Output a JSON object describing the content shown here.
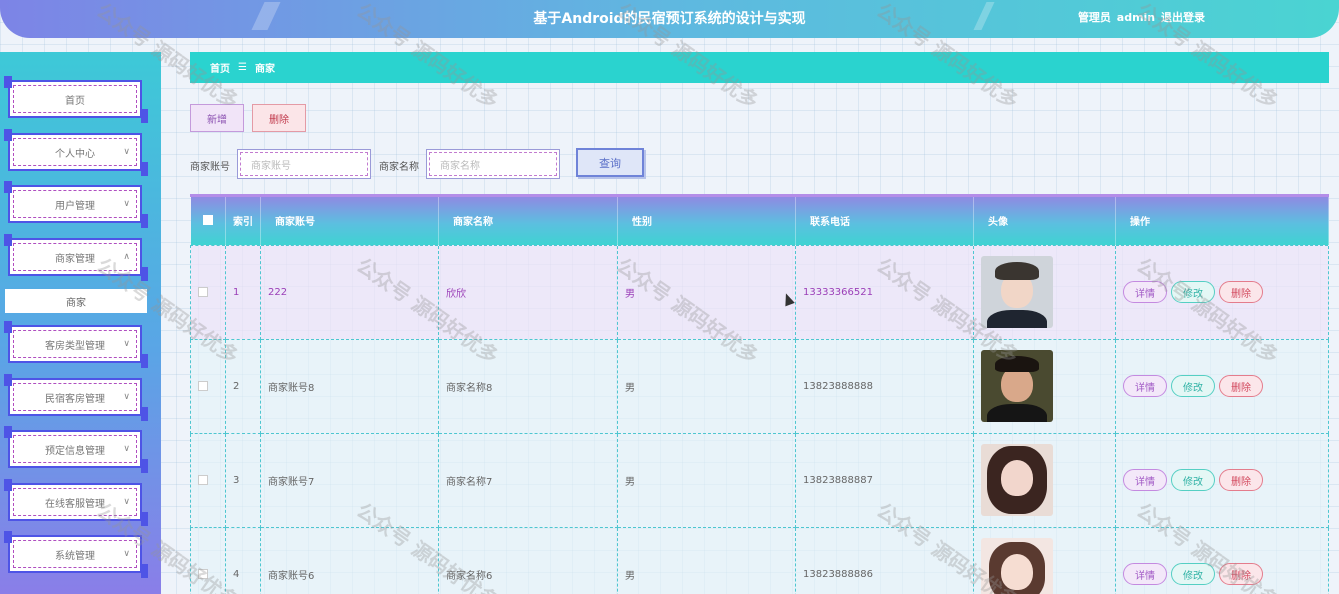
{
  "header": {
    "title": "基于Android的民宿预订系统的设计与实现",
    "user_role": "管理员",
    "username": "admin",
    "logout": "退出登录"
  },
  "sidebar": {
    "items": [
      {
        "label": "首页",
        "has_chevron": false
      },
      {
        "label": "个人中心",
        "has_chevron": true
      },
      {
        "label": "用户管理",
        "has_chevron": true
      },
      {
        "label": "商家管理",
        "has_chevron": true,
        "expanded": true
      },
      {
        "label": "客房类型管理",
        "has_chevron": true
      },
      {
        "label": "民宿客房管理",
        "has_chevron": true
      },
      {
        "label": "预定信息管理",
        "has_chevron": true
      },
      {
        "label": "在线客服管理",
        "has_chevron": true
      },
      {
        "label": "系统管理",
        "has_chevron": true
      }
    ],
    "submenu_active": "商家"
  },
  "breadcrumb": {
    "home": "首页",
    "separator": "☰",
    "current": "商家"
  },
  "toolbar": {
    "add_label": "新增",
    "delete_label": "删除"
  },
  "search": {
    "account_label": "商家账号",
    "account_placeholder": "商家账号",
    "name_label": "商家名称",
    "name_placeholder": "商家名称",
    "query_label": "查询"
  },
  "table": {
    "headers": {
      "index": "索引",
      "account": "商家账号",
      "name": "商家名称",
      "gender": "性别",
      "phone": "联系电话",
      "avatar": "头像",
      "actions": "操作"
    },
    "rows": [
      {
        "index": "1",
        "account": "222",
        "name": "欣欣",
        "gender": "男",
        "phone": "13333366521"
      },
      {
        "index": "2",
        "account": "商家账号8",
        "name": "商家名称8",
        "gender": "男",
        "phone": "13823888888"
      },
      {
        "index": "3",
        "account": "商家账号7",
        "name": "商家名称7",
        "gender": "男",
        "phone": "13823888887"
      },
      {
        "index": "4",
        "account": "商家账号6",
        "name": "商家名称6",
        "gender": "男",
        "phone": "13823888886"
      }
    ],
    "action_labels": {
      "detail": "详情",
      "edit": "修改",
      "delete": "删除"
    }
  },
  "watermark": "公众号 源码好优多",
  "colors": {
    "accent": "#2ad3cf",
    "header_gradient_start": "#7d84e6",
    "sidebar_border": "#4e54e6",
    "delete_red": "#d2485d",
    "detail_purple": "#a159c5"
  }
}
